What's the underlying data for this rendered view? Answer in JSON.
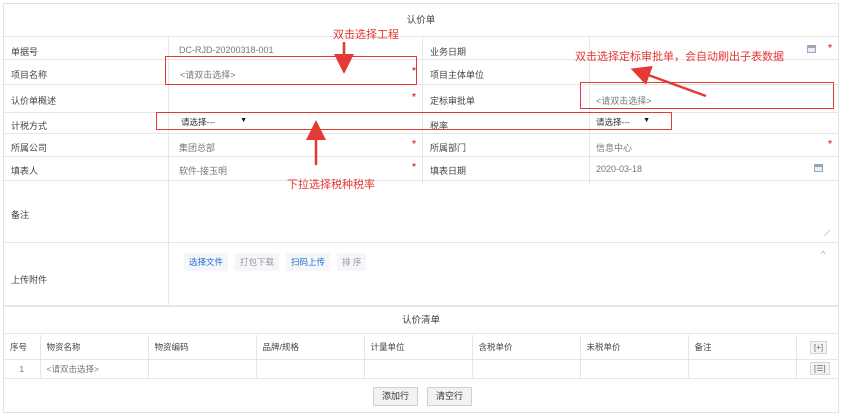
{
  "form": {
    "title": "认价单",
    "fields": {
      "doc_no_label": "单据号",
      "doc_no_value": "DC-RJD-20200318-001",
      "business_date_label": "业务日期",
      "project_label": "项目名称",
      "project_placeholder": "<请双击选择>",
      "project_owner_label": "项目主体单位",
      "summary_label": "认价单概述",
      "tender_label": "定标审批单",
      "tender_placeholder": "<请双击选择>",
      "tax_method_label": "计税方式",
      "tax_method_value": "请选择---",
      "tax_rate_label": "税率",
      "tax_rate_value": "请选择---",
      "company_label": "所属公司",
      "company_value": "集团总部",
      "dept_label": "所属部门",
      "dept_value": "信息中心",
      "filler_label": "填表人",
      "filler_value": "软件-接玉明",
      "fill_date_label": "填表日期",
      "fill_date_value": "2020-03-18",
      "remark_label": "备注",
      "attachment_label": "上传附件",
      "required_mark": "*"
    },
    "attachment_actions": [
      {
        "label": "选择文件",
        "style": "blue"
      },
      {
        "label": "打包下载",
        "style": "gray"
      },
      {
        "label": "扫码上传",
        "style": "blue"
      },
      {
        "label": "排 序",
        "style": "gray"
      }
    ],
    "collapse_glyph": "^",
    "resize_glyph": "⟋"
  },
  "detail": {
    "title": "认价清单",
    "columns": [
      "序号",
      "物资名称",
      "物资编码",
      "品牌/规格",
      "计量单位",
      "含税单价",
      "未税单价",
      "备注"
    ],
    "rows": [
      {
        "no": "1",
        "name": "<请双击选择>",
        "code": "",
        "spec": "",
        "unit": "",
        "price_tax": "",
        "price_notax": "",
        "remark": ""
      }
    ],
    "add_row_icon": "[+]",
    "row_menu_icon": "[☰]",
    "add_row_button": "添加行",
    "clear_row_button": "清空行"
  },
  "annotations": {
    "a1": "双击选择工程",
    "a2": "双击选择定标审批单，会自动刷出子表数据",
    "a3": "下拉选择税种税率",
    "color": "#e53935"
  }
}
